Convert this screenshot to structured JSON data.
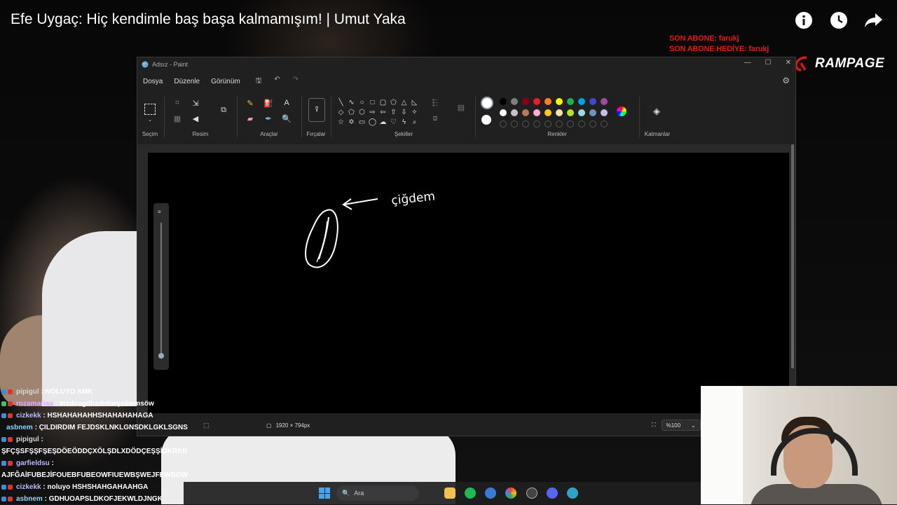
{
  "video": {
    "title": "Efe Uygaç: Hiç kendimle baş başa kalmamışım! | Umut Yaka",
    "icons": [
      "info-icon",
      "watch-later-icon",
      "share-icon"
    ]
  },
  "overlay": {
    "last_sub": "SON ABONE: farukj",
    "last_gift": "SON ABONE HEDİYE: farukj",
    "brand": "RAMPAGE"
  },
  "paint": {
    "window_title": "Adsız - Paint",
    "menu": [
      "Dosya",
      "Düzenle",
      "Görünüm"
    ],
    "groups": {
      "selection": "Seçim",
      "image": "Resim",
      "tools": "Araçlar",
      "brushes": "Fırçalar",
      "shapes": "Şekiller",
      "colors": "Renkler",
      "layers": "Katmanlar"
    },
    "palette_row1": [
      "#000000",
      "#7f7f7f",
      "#880015",
      "#ed1c24",
      "#ff7f27",
      "#fff200",
      "#22b14c",
      "#00a2e8",
      "#3f48cc",
      "#a349a4"
    ],
    "palette_row2": [
      "#ffffff",
      "#c3c3c3",
      "#b97a57",
      "#ffaec9",
      "#ffc90e",
      "#efe4b0",
      "#b5e61d",
      "#99d9ea",
      "#7092be",
      "#c8bfe7"
    ],
    "canvas_text": "çiğdem",
    "status": {
      "dimensions": "1920 × 794px",
      "zoom": "%100"
    }
  },
  "chat": [
    {
      "user": "pipigul",
      "color": "#d6d6d6",
      "text": "NOLUYO AMK",
      "badge": "#3b8fd9"
    },
    {
      "user": "rozamariaa",
      "color": "#e0a7ff",
      "text": "msdnsgdhsdnkwşsöwmsöw",
      "badge": "#39c36a"
    },
    {
      "user": "cizkekk",
      "color": "#b9b9ff",
      "text": "HSHAHAHAHHSHAHAHAHAGA",
      "badge": "#3b8fd9"
    },
    {
      "user": "asbnem",
      "color": "#8fd3ff",
      "text": "ÇILDIRDIM FEJDSKLNKLGNSDKLGKLSGNS",
      "badge": "#39c36a"
    },
    {
      "user": "pipigul",
      "color": "#d6d6d6",
      "text": "",
      "badge": "#3b8fd9"
    },
    {
      "user": "",
      "color": "#ffffff",
      "text": "ŞFÇŞSFŞŞFŞEŞDÖEÖDDÇXÖLŞDLXDÖDÇEŞŞİDKRKR",
      "badge": ""
    },
    {
      "user": "garfieldsu",
      "color": "#b9b9ff",
      "text": "",
      "badge": "#3b8fd9"
    },
    {
      "user": "",
      "color": "#ffffff",
      "text": "AJFĞAİFUBEJİFOUEBFUBEOWFIUEWBŞWEJFEWBGW",
      "badge": ""
    },
    {
      "user": "cizkekk",
      "color": "#b9b9ff",
      "text": "noluyo HSHSHAHGAHAAHGA",
      "badge": "#3b8fd9"
    },
    {
      "user": "asbnem",
      "color": "#8fd3ff",
      "text": "GDHUOAPSLDKOFJEKWLDJNGK",
      "badge": "#3b8fd9"
    }
  ],
  "taskbar": {
    "search_placeholder": "Ara"
  }
}
